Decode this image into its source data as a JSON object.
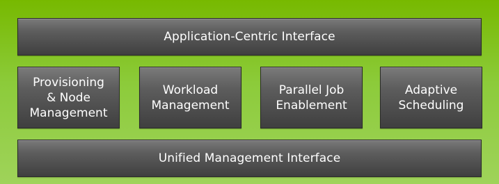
{
  "diagram": {
    "top_layer": "Application-Centric Interface",
    "middle_layer": [
      "Provisioning\n& Node\nManagement",
      "Workload\nManagement",
      "Parallel Job\nEnablement",
      "Adaptive\nScheduling"
    ],
    "bottom_layer": "Unified Management Interface"
  },
  "colors": {
    "background_green": "#77b900",
    "box_dark": "#4a4a4a",
    "text": "#ffffff"
  }
}
